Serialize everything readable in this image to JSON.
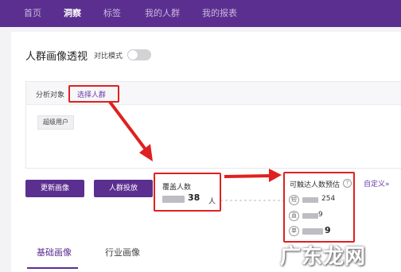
{
  "topnav": {
    "items": [
      {
        "label": "首页"
      },
      {
        "label": "洞察"
      },
      {
        "label": "标签"
      },
      {
        "label": "我的人群"
      },
      {
        "label": "我的报表"
      }
    ],
    "active": "洞察"
  },
  "page": {
    "title": "人群画像透视",
    "compare_mode_label": "对比模式",
    "compare_mode_on": false
  },
  "analysis": {
    "target_label": "分析对象",
    "select_link": "选择人群",
    "selected_tag": "超级用户"
  },
  "actions": {
    "update_label": "更新画像",
    "deliver_label": "人群投放"
  },
  "coverage": {
    "title": "覆盖人数",
    "value_suffix": "38",
    "unit": "人"
  },
  "reach": {
    "title": "可触达人数预估",
    "help_icon": "?",
    "rows": [
      {
        "badge": "短",
        "value": "254"
      },
      {
        "badge": "直",
        "value": "9"
      },
      {
        "badge": "单",
        "value": "9"
      }
    ],
    "custom_link": "自定义»"
  },
  "tabs": [
    {
      "label": "基础画像"
    },
    {
      "label": "行业画像"
    }
  ],
  "watermark": "广东龙网",
  "colors": {
    "brand": "#5b2f8f",
    "highlight": "#e02020"
  }
}
